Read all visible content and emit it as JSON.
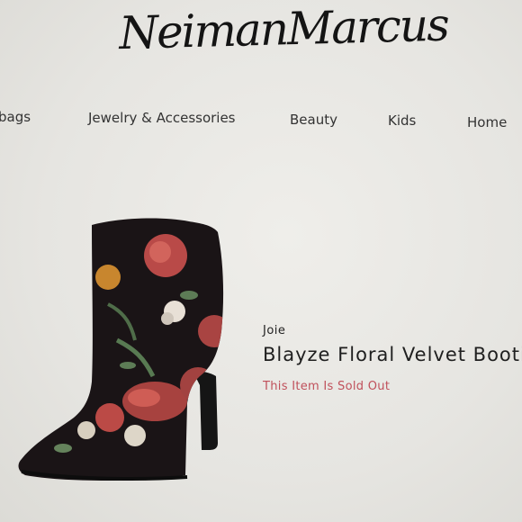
{
  "header": {
    "logo_text": "NeimanMarcus"
  },
  "nav": {
    "items": [
      {
        "label": "bags"
      },
      {
        "label": "Jewelry & Accessories"
      },
      {
        "label": "Beauty"
      },
      {
        "label": "Kids"
      },
      {
        "label": "Home"
      }
    ]
  },
  "product": {
    "brand": "Joie",
    "name": "Blayze Floral Velvet Bootie",
    "status": "This Item Is Sold Out",
    "image_icon": "floral-velvet-bootie-image"
  },
  "colors": {
    "sold_out": "#c0505b",
    "background": "#e7e6e2"
  }
}
